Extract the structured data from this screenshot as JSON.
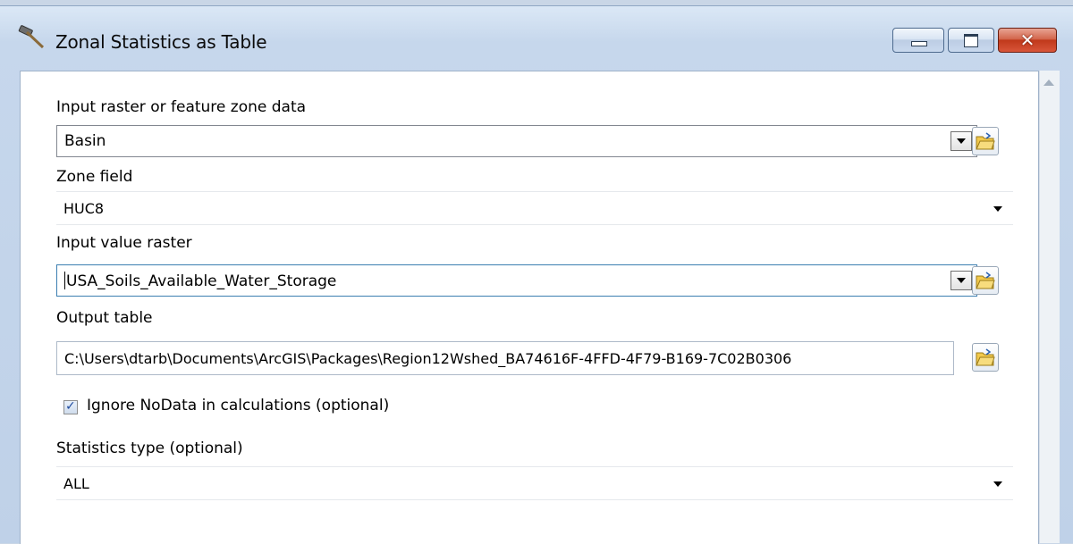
{
  "window": {
    "title": "Zonal Statistics as Table",
    "icon": "hammer-icon",
    "buttons": {
      "minimize": "minimize-icon",
      "maximize": "maximize-icon",
      "close": "✕"
    }
  },
  "form": {
    "zone_data": {
      "label": "Input raster or feature zone data",
      "value": "Basin"
    },
    "zone_field": {
      "label": "Zone field",
      "value": "HUC8"
    },
    "value_raster": {
      "label": "Input value raster",
      "value": "USA_Soils_Available_Water_Storage"
    },
    "output_table": {
      "label": "Output table",
      "value": "C:\\Users\\dtarb\\Documents\\ArcGIS\\Packages\\Region12Wshed_BA74616F-4FFD-4F79-B169-7C02B0306"
    },
    "ignore_nodata": {
      "label": "Ignore NoData in calculations (optional)",
      "checked": true
    },
    "statistics_type": {
      "label": "Statistics type (optional)",
      "value": "ALL"
    }
  },
  "colors": {
    "title_bar": "#c6d7ec",
    "close_button": "#c0391b",
    "panel": "#ffffff"
  }
}
